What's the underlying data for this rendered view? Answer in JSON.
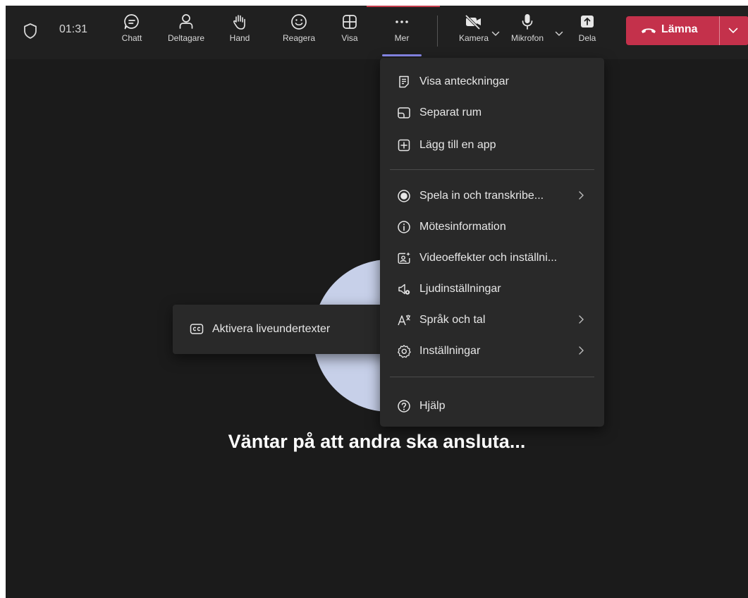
{
  "toolbar": {
    "timer": "01:31",
    "buttons": [
      {
        "label": "Chatt",
        "icon": "chat-icon"
      },
      {
        "label": "Deltagare",
        "icon": "people-icon"
      },
      {
        "label": "Hand",
        "icon": "raise-hand-icon"
      },
      {
        "label": "Reagera",
        "icon": "smiley-icon"
      },
      {
        "label": "Visa",
        "icon": "grid-view-icon"
      },
      {
        "label": "Mer",
        "icon": "more-icon"
      },
      {
        "label": "Kamera",
        "icon": "camera-off-icon"
      },
      {
        "label": "Mikrofon",
        "icon": "microphone-icon"
      },
      {
        "label": "Dela",
        "icon": "share-icon"
      }
    ],
    "leave_label": "Lämna",
    "leave_color": "#c4314b",
    "active_indicator_color": "#8b8cf0"
  },
  "menu": {
    "items": [
      {
        "label": "Visa anteckningar",
        "icon": "notes-icon"
      },
      {
        "label": "Separat rum",
        "icon": "breakout-room-icon"
      },
      {
        "label": "Lägg till en app",
        "icon": "add-app-icon"
      },
      {
        "label": "Spela in och transkribe...",
        "icon": "record-icon",
        "submenu": true
      },
      {
        "label": "Mötesinformation",
        "icon": "info-icon"
      },
      {
        "label": "Videoeffekter och inställni...",
        "icon": "video-effects-icon"
      },
      {
        "label": "Ljudinställningar",
        "icon": "audio-settings-icon"
      },
      {
        "label": "Språk och tal",
        "icon": "language-icon",
        "submenu": true
      },
      {
        "label": "Inställningar",
        "icon": "settings-gear-icon",
        "submenu": true
      },
      {
        "label": "Hjälp",
        "icon": "help-icon"
      }
    ]
  },
  "submenu": {
    "label": "Aktivera liveundertexter",
    "icon": "closed-captions-icon"
  },
  "stage": {
    "waiting_text": "Väntar på att andra ska ansluta...",
    "avatar_color": "#c7d0e9"
  }
}
